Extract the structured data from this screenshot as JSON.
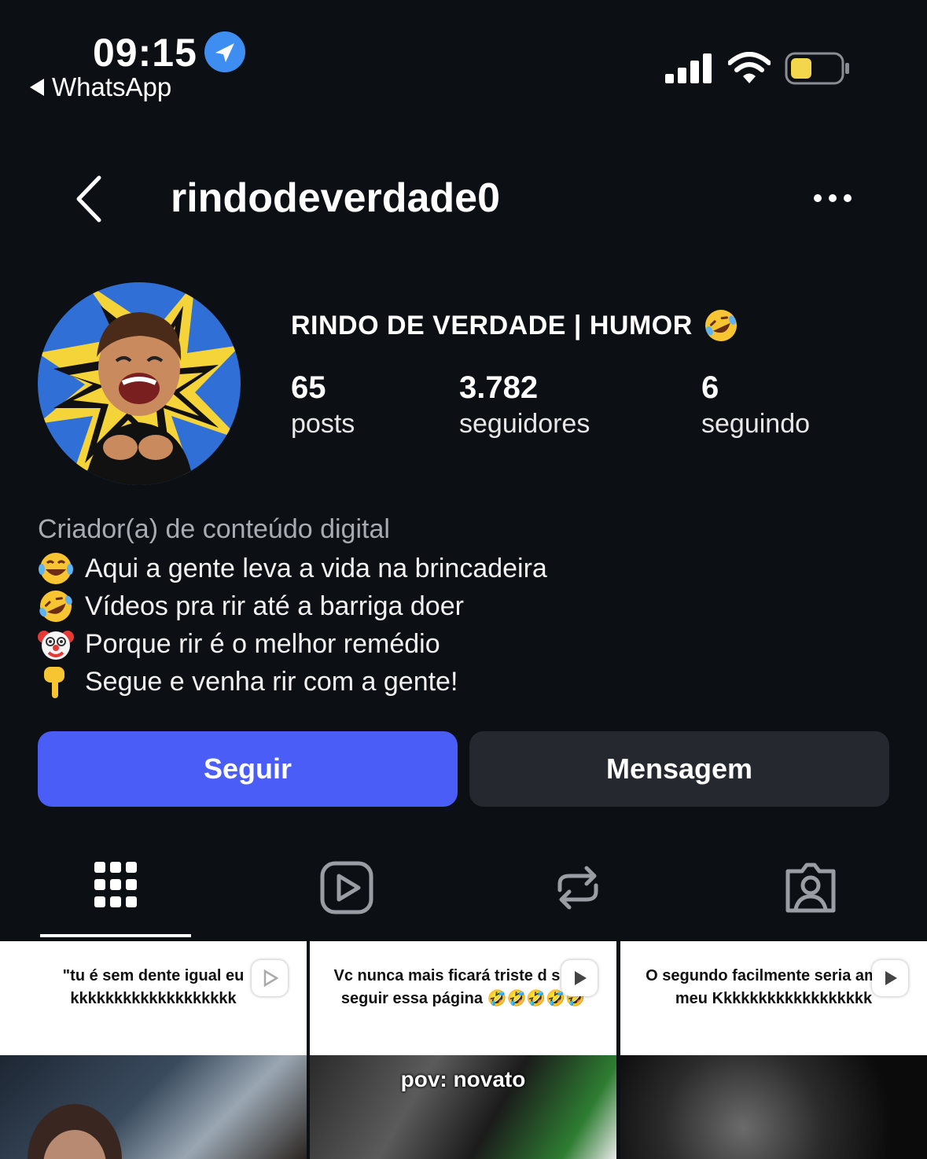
{
  "status_bar": {
    "time": "09:15",
    "back_app": "WhatsApp",
    "battery_color": "#f3d64c"
  },
  "header": {
    "username": "rindodeverdade0"
  },
  "profile": {
    "display_name": "RINDO DE VERDADE | HUMOR",
    "stats": [
      {
        "value": "65",
        "label": "posts"
      },
      {
        "value": "3.782",
        "label": "seguidores"
      },
      {
        "value": "6",
        "label": "seguindo"
      }
    ],
    "category": "Criador(a) de conteúdo digital",
    "bio": [
      {
        "icon": "tears-of-joy-icon",
        "text": "Aqui a gente leva a vida na brincadeira"
      },
      {
        "icon": "rolling-laughing-icon",
        "text": "Vídeos pra rir até a barriga doer"
      },
      {
        "icon": "clown-face-icon",
        "text": "Porque rir é o melhor remédio"
      },
      {
        "icon": "pointing-down-icon",
        "text": "Segue e venha rir com a gente!"
      }
    ]
  },
  "actions": {
    "follow_label": "Seguir",
    "message_label": "Mensagem",
    "follow_color": "#4a5df7"
  },
  "tabs": [
    {
      "icon": "grid-icon",
      "active": true
    },
    {
      "icon": "reels-icon",
      "active": false
    },
    {
      "icon": "reposts-icon",
      "active": false
    },
    {
      "icon": "tagged-icon",
      "active": false
    }
  ],
  "posts": [
    {
      "caption": "\"tu é sem dente igual eu kkkkkkkkkkkkkkkkkkk",
      "overlay": ""
    },
    {
      "caption": "Vc nunca mais ficará triste d   s que seguir essa página 🤣🤣🤣🤣🤣",
      "overlay": "pov: novato"
    },
    {
      "caption": "O segundo facilmente seria amigo meu Kkkkkkkkkkkkkkkkkk",
      "overlay": ""
    }
  ]
}
